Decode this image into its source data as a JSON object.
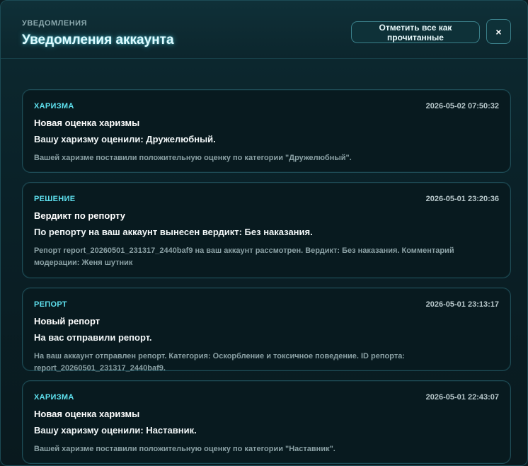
{
  "header": {
    "kicker": "УВЕДОМЛЕНИЯ",
    "title": "Уведомления аккаунта",
    "mark_all_label": "Отметить все как прочитанные",
    "close_label": "×"
  },
  "notifications": [
    {
      "category": "ХАРИЗМА",
      "timestamp": "2026-05-02 07:50:32",
      "heading": "Новая оценка харизмы",
      "message": "Вашу харизму оценили: Дружелюбный.",
      "details": "Вашей харизме поставили положительную оценку по категории \"Дружелюбный\"."
    },
    {
      "category": "РЕШЕНИЕ",
      "timestamp": "2026-05-01 23:20:36",
      "heading": "Вердикт по репорту",
      "message": "По репорту на ваш аккаунт вынесен вердикт: Без наказания.",
      "details": "Репорт report_20260501_231317_2440baf9 на ваш аккаунт рассмотрен. Вердикт: Без наказания. Комментарий модерации: Женя шутник"
    },
    {
      "category": "РЕПОРТ",
      "timestamp": "2026-05-01 23:13:17",
      "heading": "Новый репорт",
      "message": "На вас отправили репорт.",
      "details": "На ваш аккаунт отправлен репорт. Категория: Оскорбление и токсичное поведение. ID репорта: report_20260501_231317_2440baf9."
    },
    {
      "category": "ХАРИЗМА",
      "timestamp": "2026-05-01 22:43:07",
      "heading": "Новая оценка харизмы",
      "message": "Вашу харизму оценили: Наставник.",
      "details": "Вашей харизме поставили положительную оценку по категории \"Наставник\"."
    }
  ]
}
